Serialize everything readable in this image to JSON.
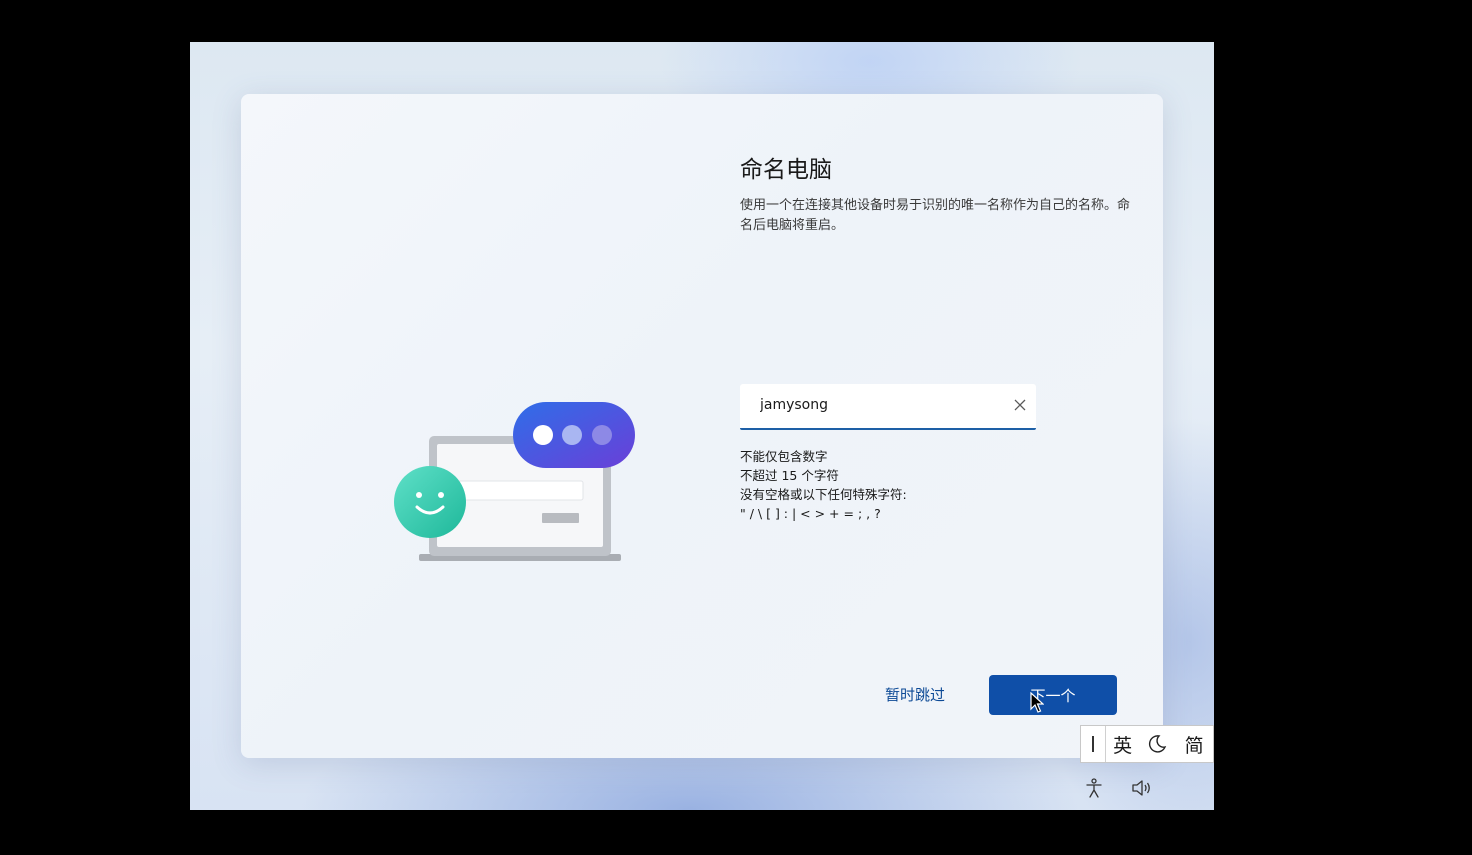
{
  "page": {
    "title": "命名电脑",
    "description": "使用一个在连接其他设备时易于识别的唯一名称作为自己的名称。命名后电脑将重启。"
  },
  "name_input": {
    "value": "jamysong",
    "placeholder": ""
  },
  "rules": [
    "不能仅包含数字",
    "不超过 15 个字符",
    "没有空格或以下任何特殊字符:",
    "\" / \\ [ ] : | < > + = ; , ?"
  ],
  "buttons": {
    "skip_label": "暂时跳过",
    "next_label": "下一个"
  },
  "ime": {
    "lang_label": "英",
    "type_label": "简"
  },
  "icons": {
    "clear": "close-icon",
    "accessibility": "accessibility-icon",
    "volume": "volume-icon",
    "half_width": "moon-icon"
  },
  "colors": {
    "accent": "#0f4fa8",
    "link": "#0d4a96",
    "input_underline": "#1d5fa6"
  }
}
